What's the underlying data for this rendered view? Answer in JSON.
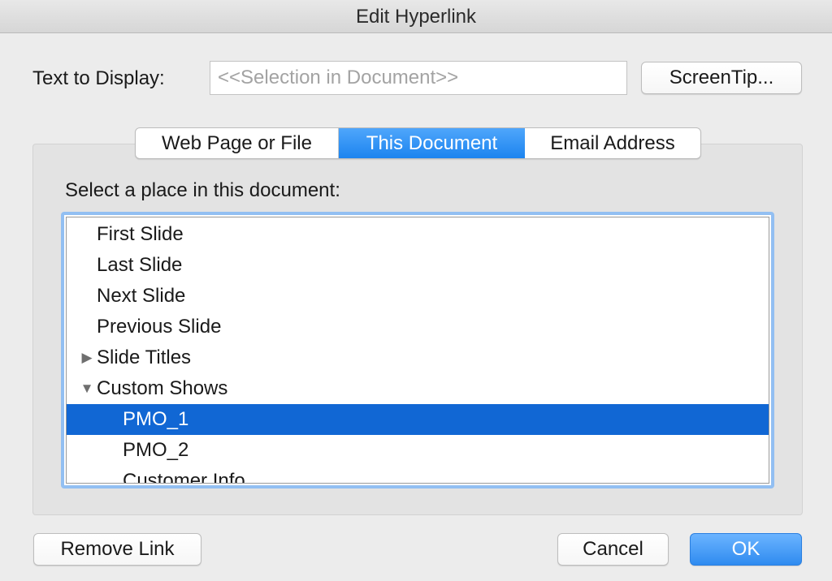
{
  "window": {
    "title": "Edit Hyperlink"
  },
  "display": {
    "label": "Text to Display:",
    "placeholder": "<<Selection in Document>>",
    "value": ""
  },
  "buttons": {
    "screentip": "ScreenTip...",
    "remove_link": "Remove Link",
    "cancel": "Cancel",
    "ok": "OK"
  },
  "tabs": [
    {
      "label": "Web Page or File",
      "selected": false
    },
    {
      "label": "This Document",
      "selected": true
    },
    {
      "label": "Email Address",
      "selected": false
    }
  ],
  "place": {
    "label": "Select a place in this document:",
    "items": [
      {
        "label": "First Slide",
        "level": 0
      },
      {
        "label": "Last Slide",
        "level": 0
      },
      {
        "label": "Next Slide",
        "level": 0
      },
      {
        "label": "Previous Slide",
        "level": 0
      },
      {
        "label": "Slide Titles",
        "level": 0,
        "expander": "▶"
      },
      {
        "label": "Custom Shows",
        "level": 0,
        "expander": "▼"
      },
      {
        "label": "PMO_1",
        "level": 1,
        "selected": true
      },
      {
        "label": "PMO_2",
        "level": 1
      },
      {
        "label": "Customer Info",
        "level": 1
      }
    ]
  },
  "icons": {
    "collapsed": "disclosure-triangle-right-icon",
    "expanded": "disclosure-triangle-down-icon"
  },
  "colors": {
    "accent": "#1167d4",
    "tab_selected": "#1c84ef",
    "ok_button": "#2f8bf0",
    "focus_ring": "#92bff2"
  }
}
